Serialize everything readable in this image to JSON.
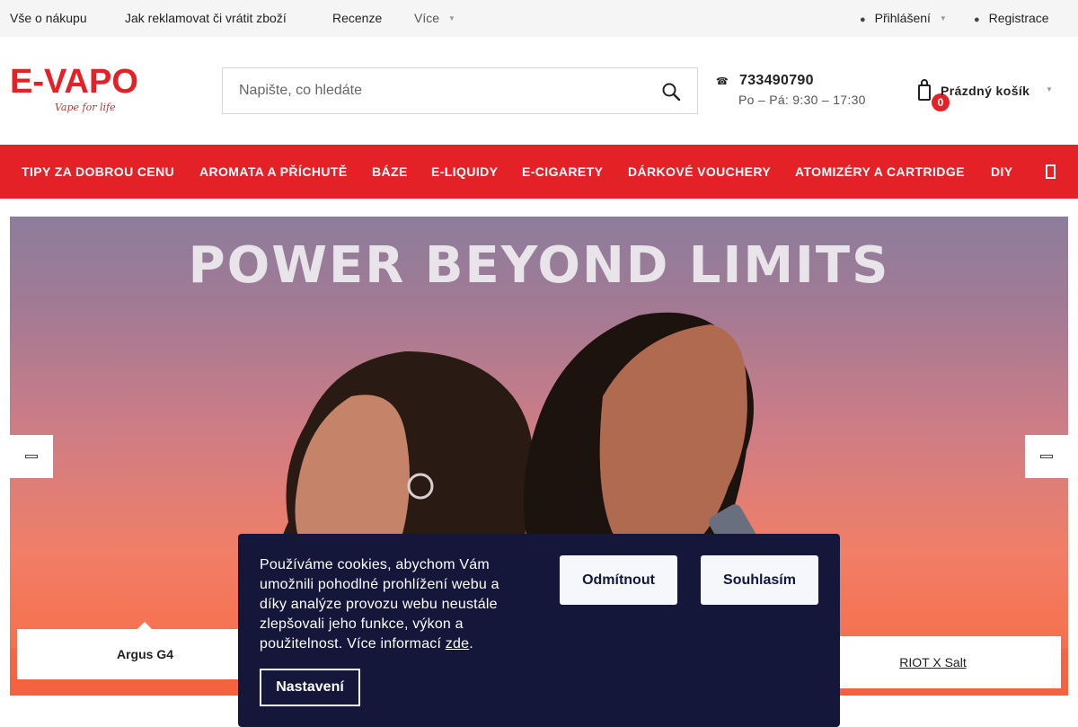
{
  "topbar": {
    "links": [
      "Vše o nákupu",
      "Jak reklamovat či vrátit zboží",
      "Recenze"
    ],
    "more_label": "Více",
    "login_label": "Přihlášení",
    "register_label": "Registrace"
  },
  "logo": {
    "name": "E-VAPO",
    "tagline": "Vape for life"
  },
  "search": {
    "placeholder": "Napište, co hledáte"
  },
  "contact": {
    "phone": "733490790",
    "hours": "Po – Pá: 9:30 – 17:30"
  },
  "cart": {
    "count": "0",
    "label": "Prázdný košík"
  },
  "nav": {
    "items": [
      "Tipy za dobrou cenu",
      "Aromata a příchutě",
      "Báze",
      "E-liquidy",
      "E-cigarety",
      "Dárkové vouchery",
      "Atomizéry a cartridge",
      "DIY"
    ]
  },
  "hero": {
    "headline": "POWER BEYOND LIMITS",
    "tab_left": "Argus G4",
    "tab_right": "RIOT X Salt"
  },
  "cookie": {
    "text": "Používáme cookies, abychom Vám umožnili pohodlné prohlížení webu a díky analýze provozu webu neustále zlepšovali jeho funkce, výkon a použitelnost. Více informací",
    "link": "zde",
    "after_link": ".",
    "reject": "Odmítnout",
    "accept": "Souhlasím",
    "settings": "Nastavení"
  },
  "colors": {
    "brand_red": "#e42126",
    "cookie_bg": "#14163a",
    "topbar_bg": "#f5f5f5"
  }
}
